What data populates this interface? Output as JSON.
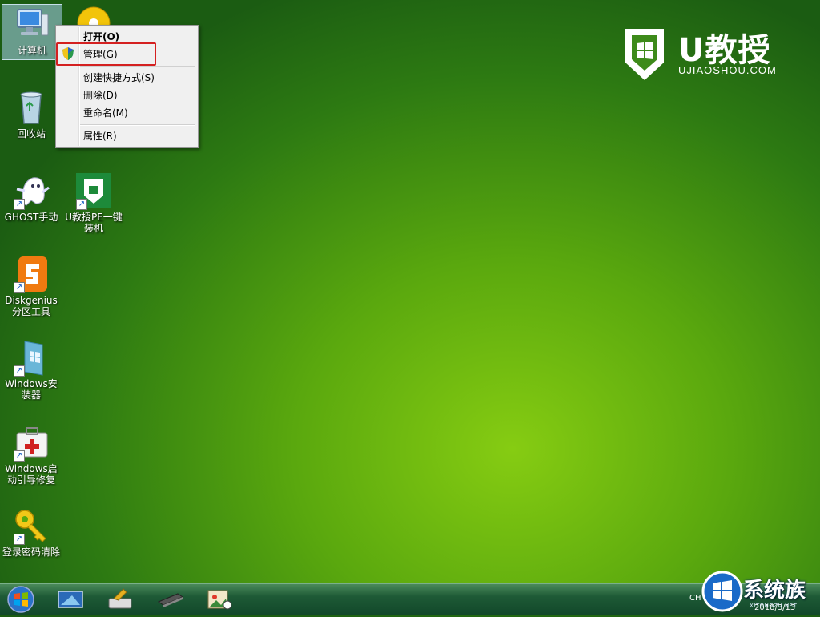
{
  "desktop": {
    "icons": [
      {
        "label": "计算机"
      },
      {
        "label": "回收站"
      },
      {
        "label": "GHOST手动"
      },
      {
        "label": "U教授PE一键装机"
      },
      {
        "label": "Diskgenius分区工具"
      },
      {
        "label": "Windows安装器"
      },
      {
        "label": "Windows启动引导修复"
      },
      {
        "label": "登录密码清除"
      }
    ]
  },
  "context_menu": {
    "items": [
      {
        "label": "打开(O)",
        "bold": true
      },
      {
        "label": "管理(G)",
        "icon": "uac-shield-icon",
        "highlighted": true
      },
      {
        "label": "创建快捷方式(S)"
      },
      {
        "label": "删除(D)"
      },
      {
        "label": "重命名(M)"
      },
      {
        "label": "属性(R)"
      }
    ]
  },
  "logo": {
    "title": "U教授",
    "url": "UJIAOSHOU.COM"
  },
  "taskbar": {
    "start": "start-orb-icon",
    "pinned": [
      "desktop-icon",
      "printer-tool-icon",
      "memory-chip-icon",
      "image-tool-icon"
    ],
    "tray_lang": "CH",
    "date": "2018/3/13"
  },
  "watermark": {
    "text": "系统族",
    "url": "XITONGZU.NET"
  },
  "colors": {
    "highlight_border": "#d42020",
    "accent_green": "#1e8a3a"
  }
}
